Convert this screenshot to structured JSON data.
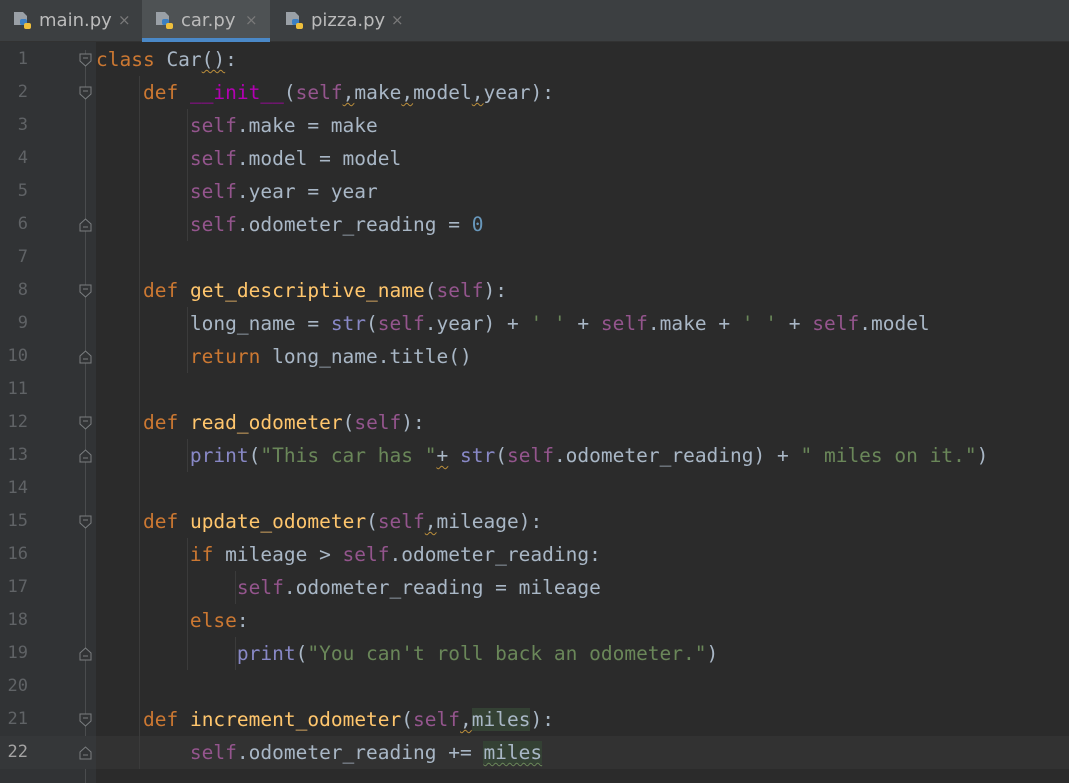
{
  "tabs": [
    {
      "label": "main.py",
      "close": "×"
    },
    {
      "label": "car.py",
      "close": "×"
    },
    {
      "label": "pizza.py",
      "close": "×"
    }
  ],
  "active_tab": "car.py",
  "current_line": 22,
  "colors": {
    "keyword": "#cc7832",
    "self": "#94558d",
    "function": "#ffc66d",
    "magic": "#b200b2",
    "builtin": "#8888c6",
    "string": "#6a8759",
    "number": "#6897bb",
    "text": "#a9b7c6",
    "accent": "#4a88c7"
  },
  "icons": {
    "file": "python-file-icon",
    "fold": "fold-marker-icon",
    "close": "close-icon"
  },
  "lines": [
    {
      "number": "1",
      "tokens": [
        [
          "kw",
          "class"
        ],
        [
          "",
          " Car"
        ],
        [
          "warn",
          "()"
        ],
        [
          "",
          ":"
        ]
      ]
    },
    {
      "number": "2",
      "tokens": [
        [
          "",
          "    "
        ],
        [
          "kw",
          "def"
        ],
        [
          "",
          " "
        ],
        [
          "mag",
          "__init__"
        ],
        [
          "",
          "("
        ],
        [
          "self",
          "self"
        ],
        [
          "warn",
          ","
        ],
        [
          "",
          "make"
        ],
        [
          "warn",
          ","
        ],
        [
          "",
          "model"
        ],
        [
          "warn",
          ","
        ],
        [
          "",
          "year):"
        ]
      ]
    },
    {
      "number": "3",
      "tokens": [
        [
          "",
          "        "
        ],
        [
          "self",
          "self"
        ],
        [
          "",
          ".make = make"
        ]
      ]
    },
    {
      "number": "4",
      "tokens": [
        [
          "",
          "        "
        ],
        [
          "self",
          "self"
        ],
        [
          "",
          ".model = model"
        ]
      ]
    },
    {
      "number": "5",
      "tokens": [
        [
          "",
          "        "
        ],
        [
          "self",
          "self"
        ],
        [
          "",
          ".year = year"
        ]
      ]
    },
    {
      "number": "6",
      "tokens": [
        [
          "",
          "        "
        ],
        [
          "self",
          "self"
        ],
        [
          "",
          ".odometer_reading = "
        ],
        [
          "num",
          "0"
        ]
      ]
    },
    {
      "number": "7",
      "tokens": []
    },
    {
      "number": "8",
      "tokens": [
        [
          "",
          "    "
        ],
        [
          "kw",
          "def"
        ],
        [
          "",
          " "
        ],
        [
          "fn",
          "get_descriptive_name"
        ],
        [
          "",
          "("
        ],
        [
          "self",
          "self"
        ],
        [
          "",
          "):"
        ]
      ]
    },
    {
      "number": "9",
      "tokens": [
        [
          "",
          "        long_name = "
        ],
        [
          "bi",
          "str"
        ],
        [
          "",
          "("
        ],
        [
          "self",
          "self"
        ],
        [
          "",
          ".year) + "
        ],
        [
          "str",
          "' '"
        ],
        [
          "",
          " + "
        ],
        [
          "self",
          "self"
        ],
        [
          "",
          ".make + "
        ],
        [
          "str",
          "' '"
        ],
        [
          "",
          " + "
        ],
        [
          "self",
          "self"
        ],
        [
          "",
          ".model"
        ]
      ]
    },
    {
      "number": "10",
      "tokens": [
        [
          "",
          "        "
        ],
        [
          "kw",
          "return"
        ],
        [
          "",
          " long_name.title()"
        ]
      ]
    },
    {
      "number": "11",
      "tokens": []
    },
    {
      "number": "12",
      "tokens": [
        [
          "",
          "    "
        ],
        [
          "kw",
          "def"
        ],
        [
          "",
          " "
        ],
        [
          "fn",
          "read_odometer"
        ],
        [
          "",
          "("
        ],
        [
          "self",
          "self"
        ],
        [
          "",
          "):"
        ]
      ]
    },
    {
      "number": "13",
      "tokens": [
        [
          "",
          "        "
        ],
        [
          "bi",
          "print"
        ],
        [
          "",
          "("
        ],
        [
          "str",
          "\"This car has \""
        ],
        [
          "warn",
          "+"
        ],
        [
          "",
          " "
        ],
        [
          "bi",
          "str"
        ],
        [
          "",
          "("
        ],
        [
          "self",
          "self"
        ],
        [
          "",
          ".odometer_reading) + "
        ],
        [
          "str",
          "\" miles on it.\""
        ],
        [
          "",
          ")"
        ]
      ]
    },
    {
      "number": "14",
      "tokens": []
    },
    {
      "number": "15",
      "tokens": [
        [
          "",
          "    "
        ],
        [
          "kw",
          "def"
        ],
        [
          "",
          " "
        ],
        [
          "fn",
          "update_odometer"
        ],
        [
          "",
          "("
        ],
        [
          "self",
          "self"
        ],
        [
          "warn",
          ","
        ],
        [
          "",
          "mileage):"
        ]
      ]
    },
    {
      "number": "16",
      "tokens": [
        [
          "",
          "        "
        ],
        [
          "kw",
          "if"
        ],
        [
          "",
          " mileage > "
        ],
        [
          "self",
          "self"
        ],
        [
          "",
          ".odometer_reading:"
        ]
      ]
    },
    {
      "number": "17",
      "tokens": [
        [
          "",
          "            "
        ],
        [
          "self",
          "self"
        ],
        [
          "",
          ".odometer_reading = mileage"
        ]
      ]
    },
    {
      "number": "18",
      "tokens": [
        [
          "",
          "        "
        ],
        [
          "kw",
          "else"
        ],
        [
          "",
          ":"
        ]
      ]
    },
    {
      "number": "19",
      "tokens": [
        [
          "",
          "            "
        ],
        [
          "bi",
          "print"
        ],
        [
          "",
          "("
        ],
        [
          "str",
          "\"You can't roll back an odometer.\""
        ],
        [
          "",
          ")"
        ]
      ]
    },
    {
      "number": "20",
      "tokens": []
    },
    {
      "number": "21",
      "tokens": [
        [
          "",
          "    "
        ],
        [
          "kw",
          "def"
        ],
        [
          "",
          " "
        ],
        [
          "fn",
          "increment_odometer"
        ],
        [
          "",
          "("
        ],
        [
          "self",
          "self"
        ],
        [
          "warn",
          ","
        ],
        [
          "hl",
          "miles"
        ],
        [
          "",
          "):"
        ]
      ]
    },
    {
      "number": "22",
      "tokens": [
        [
          "",
          "        "
        ],
        [
          "self",
          "self"
        ],
        [
          "",
          ".odometer_reading += "
        ],
        [
          "hl-warn",
          "miles"
        ]
      ]
    }
  ]
}
